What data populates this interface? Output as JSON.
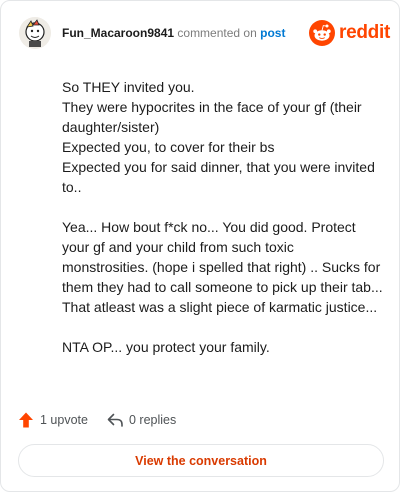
{
  "comment": {
    "username": "Fun_Macaroon9841",
    "commented_on": "commented on",
    "post_link": "post",
    "paragraphs": [
      [
        "So THEY invited you.",
        "They were hypocrites in the face of your gf (their daughter/sister)",
        "Expected you, to cover for their bs",
        "Expected you for said dinner, that you were invited to.."
      ],
      [
        "Yea... How bout f*ck no... You did good. Protect your gf and your child from such toxic monstrosities. (hope i spelled that right) .. Sucks for them they had to call someone to pick up their tab... That atleast was a slight piece of karmatic justice..."
      ],
      [
        "NTA OP... you protect your family."
      ]
    ]
  },
  "brand": {
    "name": "reddit",
    "color": "#ff4500",
    "icon": "reddit-logo-icon"
  },
  "actions": {
    "upvotes": "1 upvote",
    "upvote_icon": "upvote-arrow-icon",
    "upvote_color": "#ff4500",
    "replies": "0 replies",
    "reply_icon": "reply-arrow-icon"
  },
  "cta": {
    "label": "View the conversation",
    "color": "#d93a00"
  }
}
